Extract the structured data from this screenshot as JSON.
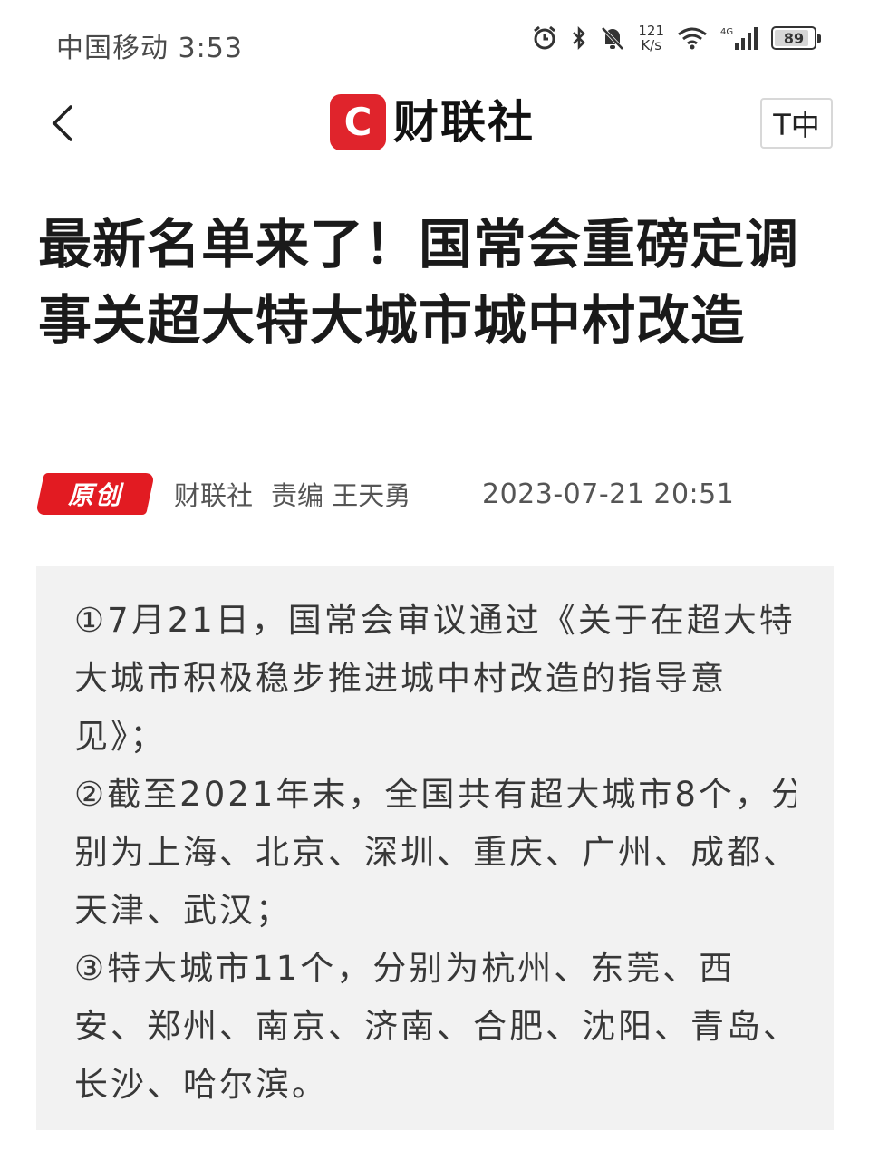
{
  "status_bar": {
    "carrier_time": "中国移动 3:53",
    "net_speed_value": "121",
    "net_speed_unit": "K/s",
    "battery_level": "89",
    "icons": [
      "alarm-icon",
      "bluetooth-icon",
      "mute-icon",
      "wifi-icon",
      "signal-4g-icon",
      "battery-icon"
    ]
  },
  "nav": {
    "back_icon": "chevron-left-icon",
    "brand_logo_letter": "C",
    "brand_name": "财联社",
    "font_size_label": "T中"
  },
  "article": {
    "title": "最新名单来了！国常会重磅定调 事关超大特大城市城中村改造",
    "badge": "原创",
    "source": "财联社",
    "editor": "责编 王天勇",
    "timestamp": "2023-07-21 20:51",
    "summary_lines": [
      "①7月21日，国常会审议通过《关于在超大特",
      "大城市积极稳步推进城中村改造的指导意",
      "见》；",
      "②截至2021年末，全国共有超大城市8个，分",
      "别为上海、北京、深圳、重庆、广州、成都、",
      "天津、武汉；",
      "③特大城市11个，分别为杭州、东莞、西",
      "安、郑州、南京、济南、合肥、沈阳、青岛、",
      "长沙、哈尔滨。"
    ]
  },
  "colors": {
    "brand_red": "#e0242c",
    "badge_red": "#e21b22",
    "summary_bg": "#f2f2f2"
  }
}
